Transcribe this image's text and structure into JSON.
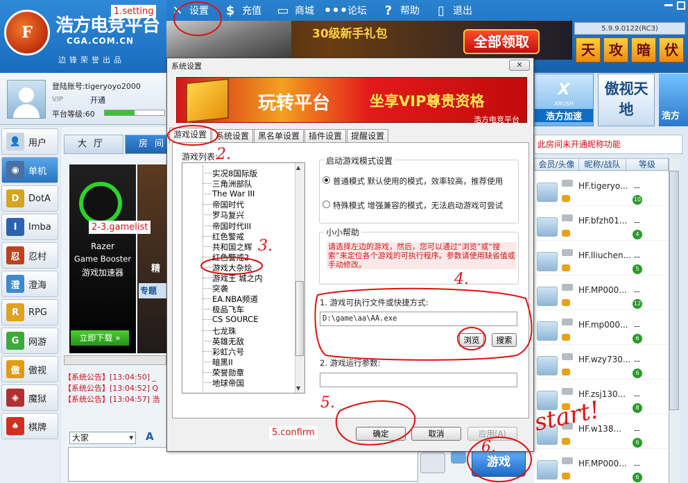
{
  "app": {
    "logo_mark": "F",
    "logo_title": "浩方电竞平台",
    "logo_domain": "CGA.COM.CN",
    "logo_slogan": "边锋荣誉出品",
    "version": "5.9.9.0122(RC3)"
  },
  "menu": [
    {
      "label": "设置",
      "icon": "wrench-icon",
      "glyph": "✕"
    },
    {
      "label": "充值",
      "icon": "dollar-icon",
      "glyph": "$"
    },
    {
      "label": "商城",
      "icon": "shop-icon",
      "glyph": "▭"
    },
    {
      "label": "论坛",
      "icon": "chat-bubble-icon",
      "glyph": "•••"
    },
    {
      "label": "帮助",
      "icon": "help-icon",
      "glyph": "?"
    },
    {
      "label": "退出",
      "icon": "exit-icon",
      "glyph": "▯"
    }
  ],
  "banner_top": {
    "gift_text": "30级新手礼包",
    "claim_label": "全部领取"
  },
  "tiles_top": [
    "天",
    "攻",
    "暗",
    "伏"
  ],
  "user": {
    "login_label": "登陆账号:tigeryoyo2000",
    "vip_label": "VIP",
    "vip_open": "开通",
    "level_label": "平台等级:60",
    "level_progress": 0.5
  },
  "nav": [
    {
      "label": "用户",
      "icon": "user-icon",
      "glyph": "👤",
      "color": "#c8d6e4"
    },
    {
      "label": "单机",
      "icon": "pc-game-icon",
      "glyph": "◉",
      "color": "#4a6fa0",
      "active": true
    },
    {
      "label": "DotA",
      "icon": "dota-icon",
      "glyph": "D",
      "color": "#d6a520"
    },
    {
      "label": "Imba",
      "icon": "imba-icon",
      "glyph": "I",
      "color": "#2c63b0"
    },
    {
      "label": "忍村",
      "icon": "ninja-icon",
      "glyph": "忍",
      "color": "#c0401c"
    },
    {
      "label": "澄海",
      "icon": "chenghai-icon",
      "glyph": "澄",
      "color": "#3c8ad0"
    },
    {
      "label": "RPG",
      "icon": "rpg-icon",
      "glyph": "R",
      "color": "#e0a020"
    },
    {
      "label": "网游",
      "icon": "online-game-icon",
      "glyph": "G",
      "color": "#3caa3c"
    },
    {
      "label": "傲视",
      "icon": "aoshi-icon",
      "glyph": "傲",
      "color": "#e29a10"
    },
    {
      "label": "魔狱",
      "icon": "moyu-icon",
      "glyph": "◈",
      "color": "#b03030"
    },
    {
      "label": "棋牌",
      "icon": "cards-icon",
      "glyph": "♠",
      "color": "#d03020"
    }
  ],
  "center": {
    "tabs": [
      "大厅",
      "房间"
    ],
    "razer_title": "Razer",
    "razer_sub": "Game Booster",
    "razer_cn": "游戏加速器",
    "razer_download": "立即下载 »",
    "poster_text": "精",
    "special_tab": "专题",
    "notices": [
      "【系统公告】[13:04:50] _",
      "【系统公告】[13:04:52] Q",
      "【系统公告】[13:04:57] 浩"
    ],
    "chat_target": "大家",
    "font_icon": "A",
    "game_button": "游戏"
  },
  "right_banners": {
    "xrush_big": "X",
    "xrush_small": "XRUSH",
    "xrush_caption": "浩方加速",
    "aoshi": "傲视天地",
    "partial": "浩方"
  },
  "room": {
    "warning": "此房间未开通昵称功能",
    "headers": [
      "会员/头像",
      "昵称/战队",
      "等级"
    ],
    "users": [
      {
        "name": "HF.tigeryo...",
        "clan": "--",
        "level": "10"
      },
      {
        "name": "HF.bfzh01...",
        "clan": "--",
        "level": "4"
      },
      {
        "name": "HF.lliuchen...",
        "clan": "--",
        "level": "5"
      },
      {
        "name": "HF.MP000...",
        "clan": "--",
        "level": "12"
      },
      {
        "name": "HF.mp000...",
        "clan": "--",
        "level": "6"
      },
      {
        "name": "HF.wzy730...",
        "clan": "--",
        "level": "6"
      },
      {
        "name": "HF.zsj130...",
        "clan": "--",
        "level": "8"
      },
      {
        "name": "HF.w138...",
        "clan": "--",
        "level": "6"
      },
      {
        "name": "HF.MP000...",
        "clan": "--",
        "level": "6"
      }
    ]
  },
  "dialog": {
    "title": "系统设置",
    "close_label": "✕",
    "banner_brand": "玩转平台",
    "banner_promo": "坐享VIP尊贵资格",
    "banner_foot": "浩方电竞平台",
    "tabs": [
      "游戏设置",
      "系统设置",
      "黑名单设置",
      "插件设置",
      "提醒设置"
    ],
    "gamelist_label": "游戏列表:",
    "games": [
      "实况8国际版",
      "三角洲部队",
      "The War III",
      "帝国时代",
      "罗马复兴",
      "帝国时代III",
      "红色警戒",
      "共和国之辉",
      "红色警戒2",
      "游戏大杂烩",
      "游戏王 城之内",
      "突袭",
      "EA.NBA频道",
      "极品飞车",
      "CS SOURCE",
      "七龙珠",
      "英雄无敌",
      "彩虹六号",
      "暗黑II",
      "荣誉勋章",
      "地球帝国"
    ],
    "mode_group": "启动游戏模式设置",
    "mode_normal": "普通模式 默认使用的模式，效率较高，推荐使用",
    "mode_special": "特殊模式 增强兼容的模式，无法启动游戏可尝试",
    "help_group": "小小帮助",
    "help_text": "请选择左边的游戏，然后，您可以通过“浏览”或“搜索”来定位各个游戏的可执行程序。参数请使用缺省值或手动修改。",
    "exe_label": "1. 游戏可执行文件或快捷方式:",
    "exe_path": "D:\\game\\aa\\AA.exe",
    "browse": "浏览",
    "search": "搜索",
    "args_label": "2. 游戏运行参数:",
    "args_value": "",
    "ok": "确定",
    "cancel": "取消",
    "apply": "应用(A)"
  },
  "annotations": {
    "setting": "1.setting",
    "gamelist": "2-3.gamelist",
    "confirm": "5.confirm",
    "n2": "2.",
    "n3": "3.",
    "n4": "4.",
    "n5": "5.",
    "n6": "6.",
    "start": "start!"
  }
}
